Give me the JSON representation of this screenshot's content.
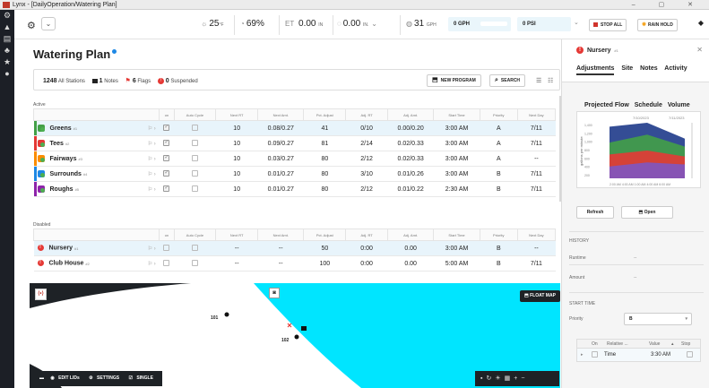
{
  "window": {
    "title": "Lynx - [DailyOperation/Watering Plan]",
    "controls": [
      "–",
      "▢",
      "✕"
    ]
  },
  "leftnav": {
    "icons": [
      "gear-icon",
      "drop-icon",
      "document-icon",
      "tree-icon",
      "star-icon",
      "flag-icon"
    ]
  },
  "topbar": {
    "temperature": "25",
    "temperature_unit": "°F",
    "humidity": "69%",
    "et_label": "ET",
    "et_value": "0.00",
    "et_unit": "IN",
    "rain_value": "0.00",
    "rain_unit": "IN.",
    "wind_value": "31",
    "wind_unit": "GPH",
    "flow_gauge_label": "0 GPH",
    "pressure_gauge_label": "0 PSI",
    "stop_all_label": "STOP ALL",
    "rain_hold_label": "RAIN HOLD"
  },
  "page": {
    "title": "Watering Plan"
  },
  "summary": {
    "stations_count": "1248",
    "stations_label": "All Stations",
    "notes_count": "1",
    "notes_label": "Notes",
    "flags_count": "6",
    "flags_label": "Flags",
    "suspended_count": "0",
    "suspended_label": "Suspended",
    "new_program_label": "NEW PROGRAM",
    "search_label": "SEARCH"
  },
  "active_section": {
    "label": "Active",
    "columns": [
      "",
      "",
      "on",
      "Auto Cycle",
      "Next RT",
      "Next Amt.",
      "Pct. Adjust",
      "Adj. RT",
      "Adj. Amt.",
      "Start Time",
      "Priority",
      "Next Day"
    ],
    "rows": [
      {
        "name": "Greens",
        "num": "#1",
        "color": "#43a047",
        "on": true,
        "auto": false,
        "next_rt": "10",
        "next_amt": "0.08/0.27",
        "pct": "41",
        "adj_rt": "0/10",
        "adj_amt": "0.00/0.20",
        "start": "3:00 AM",
        "priority": "A",
        "next_day": "7/11",
        "selected": true
      },
      {
        "name": "Tees",
        "num": "#2",
        "color": "#e53935",
        "on": true,
        "auto": false,
        "next_rt": "10",
        "next_amt": "0.09/0.27",
        "pct": "81",
        "adj_rt": "2/14",
        "adj_amt": "0.02/0.33",
        "start": "3:00 AM",
        "priority": "A",
        "next_day": "7/11",
        "selected": false
      },
      {
        "name": "Fairways",
        "num": "#3",
        "color": "#fb8c00",
        "on": true,
        "auto": false,
        "next_rt": "10",
        "next_amt": "0.03/0.27",
        "pct": "80",
        "adj_rt": "2/12",
        "adj_amt": "0.02/0.33",
        "start": "3:00 AM",
        "priority": "A",
        "next_day": "--",
        "selected": false
      },
      {
        "name": "Surrounds",
        "num": "#4",
        "color": "#1e88e5",
        "on": true,
        "auto": false,
        "next_rt": "10",
        "next_amt": "0.01/0.27",
        "pct": "80",
        "adj_rt": "3/10",
        "adj_amt": "0.01/0.26",
        "start": "3:00 AM",
        "priority": "B",
        "next_day": "7/11",
        "selected": false
      },
      {
        "name": "Roughs",
        "num": "#5",
        "color": "#8e24aa",
        "on": true,
        "auto": false,
        "next_rt": "10",
        "next_amt": "0.01/0.27",
        "pct": "80",
        "adj_rt": "2/12",
        "adj_amt": "0.01/0.22",
        "start": "2:30 AM",
        "priority": "B",
        "next_day": "7/11",
        "selected": false
      }
    ]
  },
  "disabled_section": {
    "label": "Disabled",
    "columns": [
      "",
      "",
      "on",
      "Auto Cycle",
      "Next RT",
      "Next Amt.",
      "Pct. Adjust",
      "Adj. RT",
      "Adj. Amt.",
      "Start Time",
      "Priority",
      "Next Day"
    ],
    "rows": [
      {
        "name": "Nursery",
        "num": "#1",
        "next_rt": "--",
        "next_amt": "--",
        "pct": "50",
        "adj_rt": "0:00",
        "adj_amt": "0.00",
        "start": "3:00 AM",
        "priority": "B",
        "next_day": "--",
        "selected": true
      },
      {
        "name": "Club House",
        "num": "#2",
        "next_rt": "--",
        "next_amt": "--",
        "pct": "100",
        "adj_rt": "0:00",
        "adj_amt": "0.00",
        "start": "5:00 AM",
        "priority": "B",
        "next_day": "7/11",
        "selected": false
      }
    ]
  },
  "map": {
    "float_map_label": "FLOAT MAP",
    "markers": [
      {
        "label": "101"
      },
      {
        "label": "102"
      }
    ],
    "toolbar": {
      "edit_label": "EDIT LIDs",
      "settings_label": "SETTINGS",
      "single_label": "SINGLE"
    },
    "colors": {
      "water": "#00e5ff",
      "land": "#ffffff",
      "dark": "#1e2226"
    }
  },
  "right_panel": {
    "title": "Nursery",
    "title_num": "#1",
    "tabs": [
      "Adjustments",
      "Site",
      "Notes",
      "Activity"
    ],
    "chart_tabs": [
      "Projected Flow",
      "Schedule",
      "Volume"
    ],
    "refresh_label": "Refresh",
    "open_label": "Open",
    "history_label": "HISTORY",
    "runtime_label": "Runtime",
    "runtime_value": "--",
    "amount_label": "Amount",
    "amount_value": "--",
    "start_time_label": "START TIME",
    "priority_label": "Priority",
    "priority_value": "B",
    "start_table": {
      "columns": [
        "On",
        "Relative ...",
        "Value",
        "Stop"
      ],
      "row": {
        "label": "Time",
        "value": "3:30 AM"
      }
    }
  },
  "chart_data": {
    "type": "area",
    "x": [
      "2:00 AM",
      "4:00 AM",
      "1:00 AM",
      "4:00 AM",
      "6:00 AM"
    ],
    "date_labels": [
      "7/10/2023",
      "7/11/2023"
    ],
    "ylabel": "gallons per minute",
    "yticks": [
      "1,400",
      "1,200",
      "1,000",
      "800",
      "600",
      "400",
      "200"
    ],
    "series": [
      {
        "values": [
          300,
          400,
          350
        ]
      },
      {
        "values": [
          600,
          700,
          550
        ]
      },
      {
        "values": [
          900,
          1100,
          800
        ]
      },
      {
        "values": [
          1300,
          1400,
          1000
        ]
      }
    ],
    "colors": [
      "#7e57c2",
      "#e53935",
      "#43a047",
      "#1e3a8a"
    ]
  }
}
